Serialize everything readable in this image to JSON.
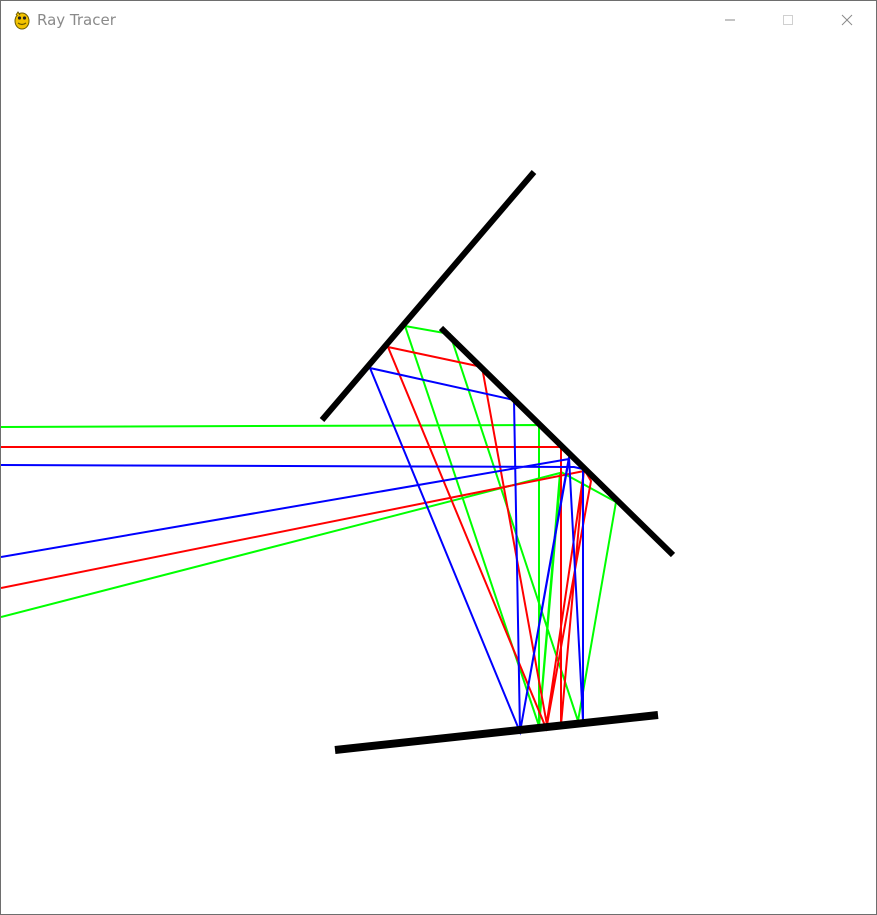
{
  "window": {
    "title": "Ray Tracer",
    "app_icon": "pygame-snake-icon",
    "controls": {
      "minimize_icon": "minimize-icon",
      "maximize_icon": "maximize-icon",
      "close_icon": "close-icon"
    }
  },
  "scene": {
    "background_color": "#ffffff",
    "mirror_color": "#000000",
    "ray_colors": {
      "green": "#00ff00",
      "red": "#ff0000",
      "blue": "#0000ff"
    }
  }
}
